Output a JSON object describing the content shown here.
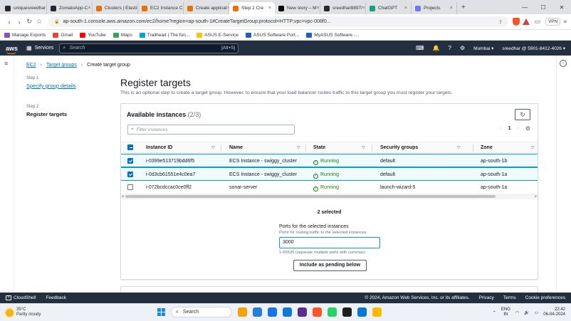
{
  "browser": {
    "tabs": [
      {
        "label": "uniquesreedhar",
        "color": "#24292f",
        "active": false
      },
      {
        "label": "ZomatoApp-C",
        "color": "#24292f",
        "active": false
      },
      {
        "label": "Clusters | Elasti",
        "color": "#ed7100",
        "active": false
      },
      {
        "label": "EC2 Instance C",
        "color": "#ed7100",
        "active": false
      },
      {
        "label": "Create applicat",
        "color": "#ed7100",
        "active": false
      },
      {
        "label": "Step 2 Cre",
        "color": "#ed7100",
        "active": true
      },
      {
        "label": "New story – M",
        "color": "#000000",
        "active": false
      },
      {
        "label": "sreedhar8897/",
        "color": "#24292f",
        "active": false
      },
      {
        "label": "ChatGPT",
        "color": "#10a37f",
        "active": false
      },
      {
        "label": "Projects",
        "color": "#6b7cff",
        "active": false
      }
    ],
    "url": "ap-south-1.console.aws.amazon.com/ec2/home?region=ap-south-1#CreateTargetGroup:protocol=HTTP;vpc=vpc-008f0...",
    "vpn_label": "VPN",
    "bookmarks": [
      {
        "label": "Manage Exports",
        "color": "#7e57c2"
      },
      {
        "label": "Gmail",
        "color": "#ea4335"
      },
      {
        "label": "YouTube",
        "color": "#ff0000"
      },
      {
        "label": "Maps",
        "color": "#34a853"
      },
      {
        "label": "Trailhead | The fun...",
        "color": "#00a1e0"
      },
      {
        "label": "ASUS E-Service",
        "color": "#ffc107"
      },
      {
        "label": "ASUS Software Port...",
        "color": "#1565c0"
      },
      {
        "label": "MyASUS Software -...",
        "color": "#1565c0"
      }
    ]
  },
  "aws_nav": {
    "logo": "aws",
    "services": "Services",
    "search_placeholder": "Search",
    "search_shortcut": "[Alt+S]",
    "region": "Mumbai ▾",
    "account": "sreedhar @ 5901-8412-4026 ▾"
  },
  "breadcrumb": {
    "root": "EC2",
    "parent": "Target groups",
    "current": "Create target group"
  },
  "steps": [
    {
      "label": "Step 1",
      "title": "Specify group details",
      "current": false
    },
    {
      "label": "Step 2",
      "title": "Register targets",
      "current": true
    }
  ],
  "page": {
    "title": "Register targets",
    "description": "This is an optional step to create a target group. However, to ensure that your load balancer routes traffic to this target group you must register your targets."
  },
  "instances": {
    "title": "Available instances",
    "count": "(2/3)",
    "filter_placeholder": "Filter instances",
    "page_number": "1",
    "columns": [
      "Instance ID",
      "Name",
      "State",
      "Security groups",
      "Zone"
    ],
    "rows": [
      {
        "id": "i-0399e513719bdd6f5",
        "name": "ECS Instance - swiggy_cluster",
        "state": "Running",
        "sg": "default",
        "zone": "ap-south-1b",
        "selected": true
      },
      {
        "id": "i-0d3cb61551e4c0ea7",
        "name": "ECS Instance - swiggy_cluster",
        "state": "Running",
        "sg": "default",
        "zone": "ap-south-1a",
        "selected": true
      },
      {
        "id": "i-072bcdccac0ce0ff2",
        "name": "sonar-server",
        "state": "Running",
        "sg": "launch-wizard-5",
        "zone": "ap-south-1a",
        "selected": false
      }
    ]
  },
  "ports": {
    "selected_text": "2 selected",
    "label": "Ports for the selected instances",
    "sublabel": "Ports for routing traffic to the selected instances.",
    "value": "3000",
    "hint": "1-65535 (separate multiple ports with commas)",
    "button": "Include as pending below"
  },
  "footer": {
    "cloudshell": "CloudShell",
    "feedback": "Feedback",
    "copyright": "© 2024, Amazon Web Services, Inc. or its affiliates.",
    "privacy": "Privacy",
    "terms": "Terms",
    "cookies": "Cookie preferences"
  },
  "taskbar": {
    "temp": "35°C",
    "weather": "Partly cloudy",
    "search": "Search",
    "lang1": "ENG",
    "lang2": "IN",
    "time": "22:42",
    "date": "06-04-2024",
    "apps": [
      "#f4a300",
      "#2b7bd9",
      "#1a73e8",
      "#0f7bd8",
      "#5c2d91",
      "#fb542b",
      "#25d366",
      "#1e1e1e",
      "#0078d4",
      "#ffb900"
    ]
  }
}
